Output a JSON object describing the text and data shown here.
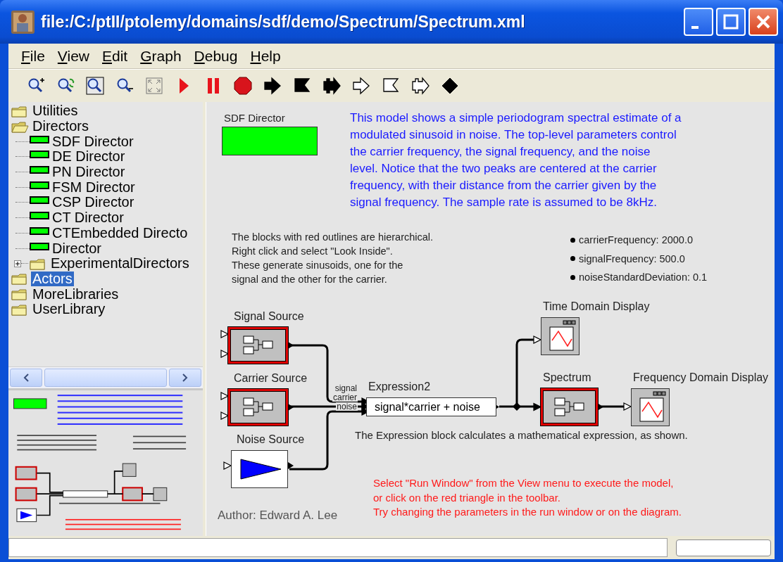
{
  "window": {
    "title": "file:/C:/ptII/ptolemy/domains/sdf/demo/Spectrum/Spectrum.xml"
  },
  "menu": [
    "File",
    "View",
    "Edit",
    "Graph",
    "Debug",
    "Help"
  ],
  "toolbar": [
    {
      "kind": "zoom-in"
    },
    {
      "kind": "zoom-reset"
    },
    {
      "kind": "zoom-fit"
    },
    {
      "kind": "zoom-out"
    },
    {
      "kind": "fullscreen"
    },
    {
      "kind": "run"
    },
    {
      "kind": "pause"
    },
    {
      "kind": "stop"
    },
    {
      "kind": "arrow",
      "filled": true
    },
    {
      "kind": "flag",
      "filled": true
    },
    {
      "kind": "tab",
      "filled": true
    },
    {
      "kind": "arrow",
      "filled": false
    },
    {
      "kind": "flag",
      "filled": false
    },
    {
      "kind": "tab",
      "filled": false
    },
    {
      "kind": "diamond",
      "filled": true
    }
  ],
  "library": {
    "items": [
      {
        "label": "Utilities",
        "kind": "folder",
        "expanded": false,
        "selected": false
      },
      {
        "label": "Directors",
        "kind": "folder",
        "expanded": true,
        "selected": false,
        "children": [
          {
            "label": "SDF Director",
            "kind": "director",
            "selected": false
          },
          {
            "label": "DE Director",
            "kind": "director",
            "selected": false
          },
          {
            "label": "PN Director",
            "kind": "director",
            "selected": false
          },
          {
            "label": "FSM Director",
            "kind": "director",
            "selected": false
          },
          {
            "label": "CSP Director",
            "kind": "director",
            "selected": false
          },
          {
            "label": "CT Director",
            "kind": "director",
            "selected": false
          },
          {
            "label": "CTEmbedded Directo",
            "kind": "director",
            "selected": false
          },
          {
            "label": "Director",
            "kind": "director",
            "selected": false
          },
          {
            "label": "ExperimentalDirectors",
            "kind": "folder",
            "expanded": false,
            "selected": false
          }
        ]
      },
      {
        "label": "Actors",
        "kind": "folder",
        "expanded": false,
        "selected": true
      },
      {
        "label": "MoreLibraries",
        "kind": "folder",
        "expanded": false,
        "selected": false
      },
      {
        "label": "UserLibrary",
        "kind": "folder",
        "expanded": false,
        "selected": false
      }
    ]
  },
  "model": {
    "director": "SDF Director",
    "description": "This model shows a simple periodogram spectral estimate of a\nmodulated sinusoid in noise. The top-level parameters control\nthe carrier frequency, the signal frequency, and the noise\nlevel. Notice that the two peaks are centered at the carrier\nfrequency, with their distance from the carrier given by the\nsignal frequency. The sample rate is assumed to be 8kHz.",
    "note": "The blocks with red outlines are hierarchical.\nRight click and select \"Look Inside\".\nThese generate sinusoids, one for the\nsignal and the other for the carrier.",
    "parameters": [
      "carrierFrequency: 2000.0",
      "signalFrequency: 500.0",
      "noiseStandardDeviation: 0.1"
    ],
    "actors": [
      {
        "label": "Signal Source",
        "kind": "composite"
      },
      {
        "label": "Carrier Source",
        "kind": "composite"
      },
      {
        "label": "Noise Source",
        "kind": "source"
      },
      {
        "label": "Expression2",
        "kind": "expression",
        "expression": "signal*carrier + noise",
        "ports": [
          "signal",
          "carrier",
          "noise"
        ]
      },
      {
        "label": "Time Domain Display",
        "kind": "display"
      },
      {
        "label": "Spectrum",
        "kind": "composite"
      },
      {
        "label": "Frequency Domain Display",
        "kind": "display"
      }
    ],
    "expression_note": "The Expression block calculates a mathematical expression, as shown.",
    "run_note": "Select \"Run Window\" from the View menu to execute the model,\nor click on the red triangle in the toolbar.\nTry changing the parameters in the run window or on the diagram.",
    "author": "Author: Edward A. Lee"
  }
}
